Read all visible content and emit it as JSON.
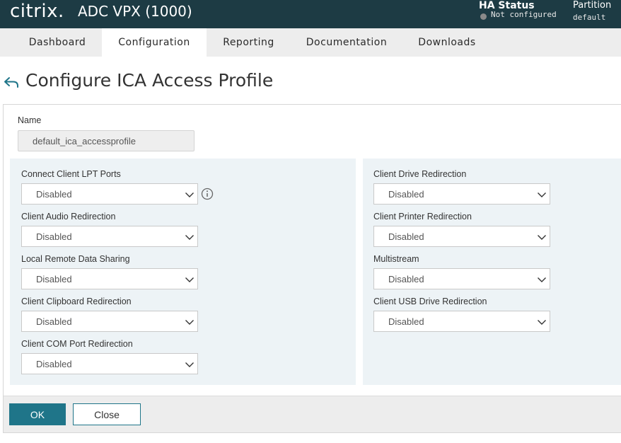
{
  "header": {
    "logo_text": "citrix.",
    "product_title": "ADC VPX (1000)",
    "ha_status_label": "HA Status",
    "ha_status_value": "Not configured",
    "partition_label": "Partition",
    "partition_value": "default"
  },
  "nav": {
    "tabs": [
      {
        "label": "Dashboard",
        "active": false
      },
      {
        "label": "Configuration",
        "active": true
      },
      {
        "label": "Reporting",
        "active": false
      },
      {
        "label": "Documentation",
        "active": false
      },
      {
        "label": "Downloads",
        "active": false
      }
    ]
  },
  "page": {
    "title": "Configure ICA Access Profile"
  },
  "form": {
    "name_label": "Name",
    "name_value": "default_ica_accessprofile",
    "left_fields": [
      {
        "label": "Connect Client LPT Ports",
        "value": "Disabled"
      },
      {
        "label": "Client Audio Redirection",
        "value": "Disabled"
      },
      {
        "label": "Local Remote Data Sharing",
        "value": "Disabled"
      },
      {
        "label": "Client Clipboard Redirection",
        "value": "Disabled"
      },
      {
        "label": "Client COM Port Redirection",
        "value": "Disabled"
      }
    ],
    "right_fields": [
      {
        "label": "Client Drive Redirection",
        "value": "Disabled"
      },
      {
        "label": "Client Printer Redirection",
        "value": "Disabled"
      },
      {
        "label": "Multistream",
        "value": "Disabled"
      },
      {
        "label": "Client USB Drive Redirection",
        "value": "Disabled"
      }
    ]
  },
  "footer": {
    "ok_label": "OK",
    "close_label": "Close"
  },
  "colors": {
    "header_bg": "#1d3b44",
    "accent": "#1f7589",
    "group_bg": "#edf3f6"
  },
  "icons": [
    "back-arrow-icon",
    "info-icon",
    "chevron-down-icon",
    "status-dot-icon"
  ]
}
